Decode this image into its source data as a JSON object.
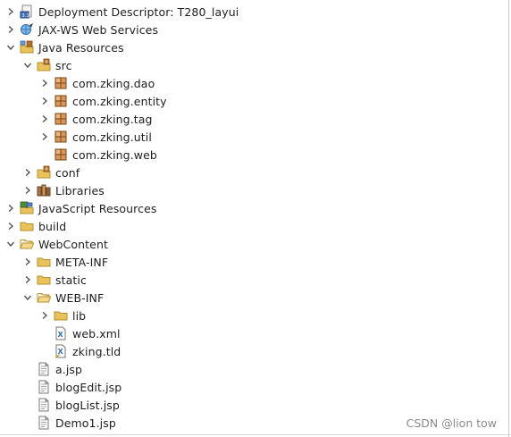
{
  "tree": {
    "items": [
      {
        "label": "Deployment Descriptor: T280_layui",
        "icon": "deployment-descriptor-icon",
        "expanded": false,
        "indent": 0
      },
      {
        "label": "JAX-WS Web Services",
        "icon": "web-services-icon",
        "expanded": false,
        "indent": 0
      },
      {
        "label": "Java Resources",
        "icon": "java-resources-icon",
        "expanded": true,
        "indent": 0
      },
      {
        "label": "src",
        "icon": "source-folder-icon",
        "expanded": true,
        "indent": 1
      },
      {
        "label": "com.zking.dao",
        "icon": "package-icon",
        "expanded": false,
        "indent": 2
      },
      {
        "label": "com.zking.entity",
        "icon": "package-icon",
        "expanded": false,
        "indent": 2
      },
      {
        "label": "com.zking.tag",
        "icon": "package-icon",
        "expanded": false,
        "indent": 2
      },
      {
        "label": "com.zking.util",
        "icon": "package-icon",
        "expanded": false,
        "indent": 2
      },
      {
        "label": "com.zking.web",
        "icon": "package-icon",
        "expanded": null,
        "indent": 2
      },
      {
        "label": "conf",
        "icon": "source-folder-icon",
        "expanded": false,
        "indent": 1
      },
      {
        "label": "Libraries",
        "icon": "libraries-icon",
        "expanded": false,
        "indent": 1
      },
      {
        "label": "JavaScript Resources",
        "icon": "javascript-resources-icon",
        "expanded": false,
        "indent": 0
      },
      {
        "label": "build",
        "icon": "folder-icon",
        "expanded": false,
        "indent": 0
      },
      {
        "label": "WebContent",
        "icon": "folder-open-icon",
        "expanded": true,
        "indent": 0
      },
      {
        "label": "META-INF",
        "icon": "folder-icon",
        "expanded": false,
        "indent": 1
      },
      {
        "label": "static",
        "icon": "folder-icon",
        "expanded": false,
        "indent": 1
      },
      {
        "label": "WEB-INF",
        "icon": "folder-open-icon",
        "expanded": true,
        "indent": 1
      },
      {
        "label": "lib",
        "icon": "folder-icon",
        "expanded": false,
        "indent": 2
      },
      {
        "label": "web.xml",
        "icon": "xml-file-icon",
        "expanded": null,
        "indent": 2
      },
      {
        "label": "zking.tld",
        "icon": "tld-file-icon",
        "expanded": null,
        "indent": 2
      },
      {
        "label": "a.jsp",
        "icon": "jsp-file-icon",
        "expanded": null,
        "indent": 1
      },
      {
        "label": "blogEdit.jsp",
        "icon": "jsp-file-icon",
        "expanded": null,
        "indent": 1
      },
      {
        "label": "blogList.jsp",
        "icon": "jsp-file-icon",
        "expanded": null,
        "indent": 1
      },
      {
        "label": "Demo1.jsp",
        "icon": "jsp-file-icon",
        "expanded": null,
        "indent": 1
      }
    ]
  },
  "watermark": "CSDN @lion tow",
  "colors": {
    "chevron": "#555555",
    "folder": "#e8c25c",
    "folder_stroke": "#b8902e",
    "package": "#b5712a",
    "accent_blue": "#2f6fb5"
  }
}
